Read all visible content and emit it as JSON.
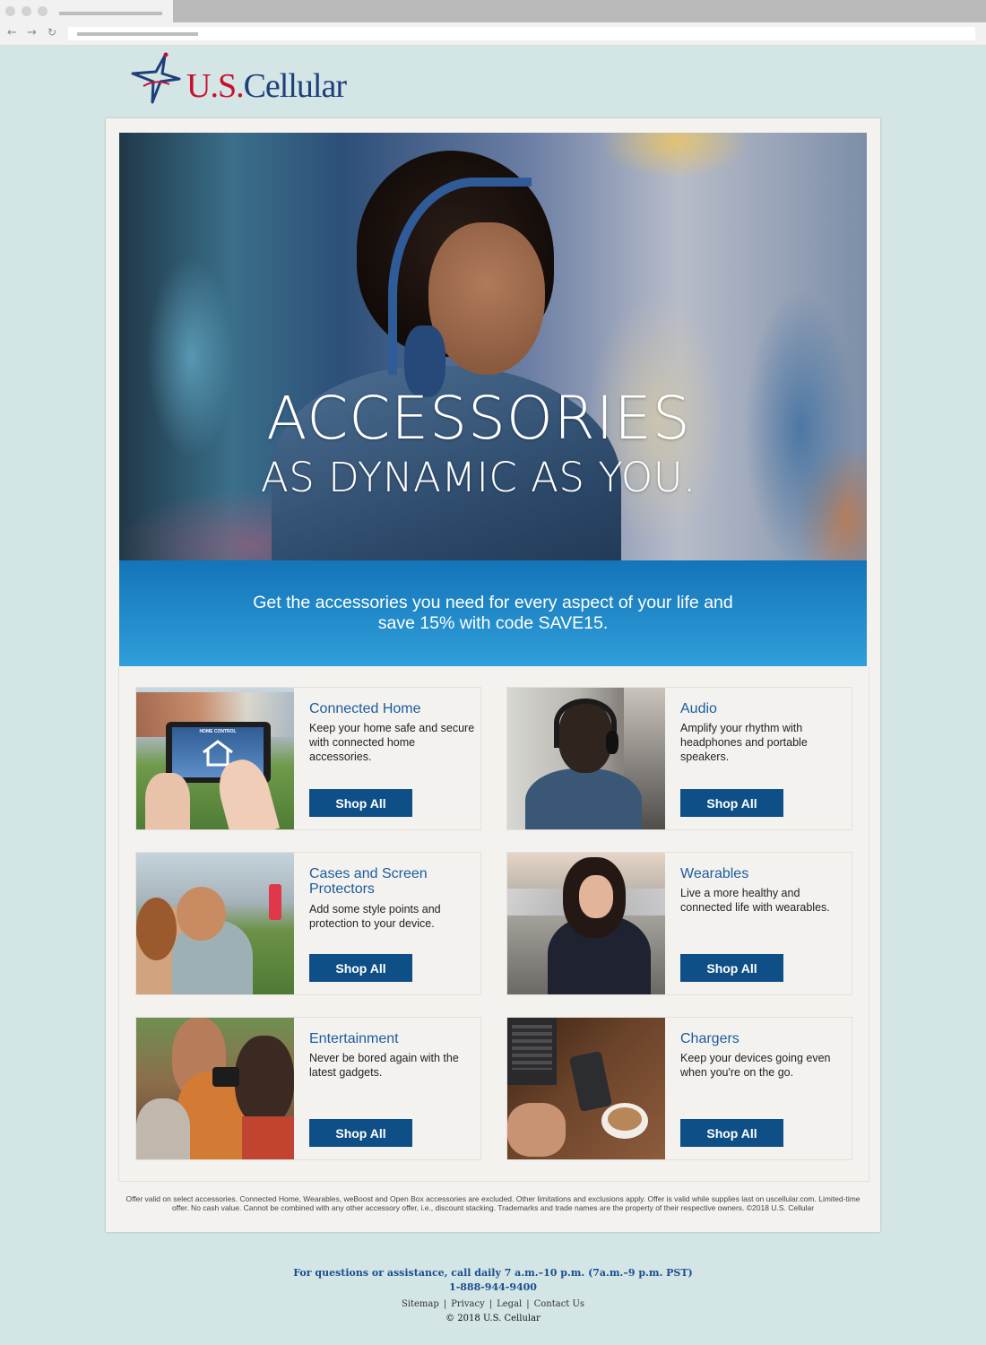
{
  "brand": {
    "name_us": "U.S.",
    "name_cellular": "Cellular",
    "color_red": "#c8102e",
    "color_navy": "#1f3f7a"
  },
  "hero": {
    "title_line1": "ACCESSORIES",
    "title_line2": "AS DYNAMIC AS YOU."
  },
  "promo": {
    "line1": "Get the accessories you need for every aspect of your life and",
    "line2": "save 15% with code SAVE15."
  },
  "categories": [
    {
      "title": "Connected Home",
      "desc": "Keep your home safe and secure with connected home accessories.",
      "button": "Shop All",
      "image_label": "HOME CONTROL"
    },
    {
      "title": "Audio",
      "desc": "Amplify your rhythm with headphones and portable speakers.",
      "button": "Shop All"
    },
    {
      "title": "Cases and Screen Protectors",
      "desc": "Add some style points and protection to your device.",
      "button": "Shop All"
    },
    {
      "title": "Wearables",
      "desc": "Live a more healthy and connected life with wearables.",
      "button": "Shop All"
    },
    {
      "title": "Entertainment",
      "desc": "Never be bored again with the latest gadgets.",
      "button": "Shop All"
    },
    {
      "title": "Chargers",
      "desc": "Keep your devices going even when you're on the go.",
      "button": "Shop All"
    }
  ],
  "disclaimer": "Offer valid on select accessories. Connected Home, Wearables, weBoost and Open Box accessories are excluded. Other limitations and exclusions apply. Offer is valid while supplies last on uscellular.com. Limited-time offer. No cash value. Cannot be combined with any other accessory offer, i.e., discount stacking. Trademarks and trade names are the property of their respective owners. ©2018 U.S. Cellular",
  "footer": {
    "question": "For questions or assistance, call daily 7 a.m.–10 p.m. (7a.m.–9 p.m. PST)",
    "phone": "1-888-944-9400",
    "links": [
      "Sitemap",
      "Privacy",
      "Legal",
      "Contact Us"
    ],
    "copyright": "© 2018 U.S. Cellular"
  },
  "colors": {
    "background": "#d3e5e5",
    "button": "#0f4f87",
    "title_blue": "#1b5c9e",
    "promo_blue": "#1474b9"
  }
}
